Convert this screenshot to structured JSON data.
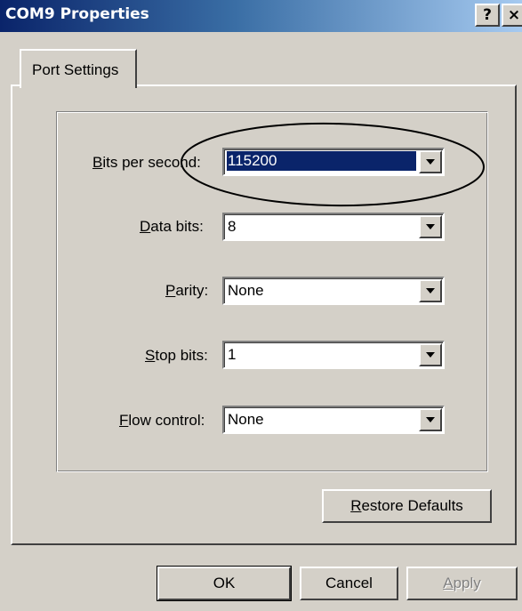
{
  "window": {
    "title": "COM9 Properties",
    "help_glyph": "?",
    "close_glyph": "×"
  },
  "tabs": [
    {
      "label": "Port Settings",
      "active": true
    }
  ],
  "fields": [
    {
      "label_pre": "",
      "label_mnemonic": "B",
      "label_post": "its per second:",
      "value": "115200",
      "selected": true
    },
    {
      "label_pre": "",
      "label_mnemonic": "D",
      "label_post": "ata bits:",
      "value": "8",
      "selected": false
    },
    {
      "label_pre": "",
      "label_mnemonic": "P",
      "label_post": "arity:",
      "value": "None",
      "selected": false
    },
    {
      "label_pre": "",
      "label_mnemonic": "S",
      "label_post": "top bits:",
      "value": "1",
      "selected": false
    },
    {
      "label_pre": "",
      "label_mnemonic": "F",
      "label_post": "low control:",
      "value": "None",
      "selected": false
    }
  ],
  "buttons": {
    "restore_mnemonic": "R",
    "restore_rest": "estore Defaults",
    "ok": "OK",
    "cancel": "Cancel",
    "apply_mnemonic": "A",
    "apply_rest": "pply"
  },
  "colors": {
    "face": "#d4d0c8",
    "title_start": "#0a246a",
    "title_end": "#a6caf0",
    "selection": "#0a246a"
  },
  "icons": {
    "dropdown": "chevron-down-icon",
    "help": "help-icon",
    "close": "close-icon"
  }
}
